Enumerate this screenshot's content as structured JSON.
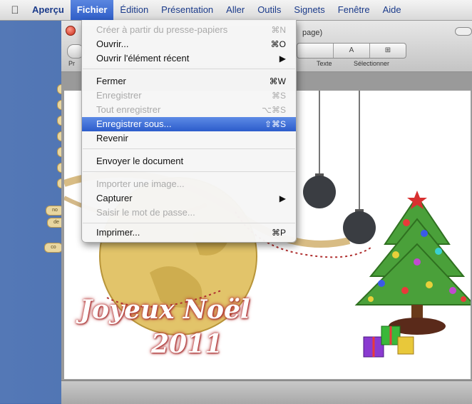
{
  "menubar": {
    "app_name": "Aperçu",
    "items": [
      "Fichier",
      "Édition",
      "Présentation",
      "Aller",
      "Outils",
      "Signets",
      "Fenêtre",
      "Aide"
    ],
    "active": "Fichier"
  },
  "window": {
    "title_fragment": "page)",
    "segmented": {
      "left": "A",
      "right": "⊞"
    },
    "tool_labels": {
      "left": "Pr",
      "text": "Texte",
      "select": "Sélectionner"
    }
  },
  "side_tags": [
    "no",
    "de",
    "co"
  ],
  "document": {
    "greeting_line1": "Joyeux Noël",
    "greeting_line2": "2011"
  },
  "file_menu": {
    "items": [
      {
        "label": "Créer à partir du presse-papiers",
        "shortcut": "⌘N",
        "disabled": true
      },
      {
        "label": "Ouvrir...",
        "shortcut": "⌘O",
        "disabled": false
      },
      {
        "label": "Ouvrir l'élément récent",
        "shortcut": "▶",
        "disabled": false
      },
      {
        "label": "Fermer",
        "shortcut": "⌘W",
        "disabled": false
      },
      {
        "label": "Enregistrer",
        "shortcut": "⌘S",
        "disabled": true
      },
      {
        "label": "Tout enregistrer",
        "shortcut": "⌥⌘S",
        "disabled": true
      },
      {
        "label": "Enregistrer sous...",
        "shortcut": "⇧⌘S",
        "disabled": false,
        "highlighted": true
      },
      {
        "label": "Revenir",
        "shortcut": "",
        "disabled": false
      },
      {
        "label": "Envoyer le document",
        "shortcut": "",
        "disabled": false
      },
      {
        "label": "Importer une image...",
        "shortcut": "",
        "disabled": true
      },
      {
        "label": "Capturer",
        "shortcut": "▶",
        "disabled": false
      },
      {
        "label": "Saisir le mot de passe...",
        "shortcut": "",
        "disabled": true
      },
      {
        "label": "Imprimer...",
        "shortcut": "⌘P",
        "disabled": false
      }
    ]
  },
  "colors": {
    "menu_highlight": "#3a6ad6",
    "desktop": "#4a6fb0",
    "ornament": "#3a3d42",
    "tree_green": "#4aa03a",
    "globe_gold": "#d9b85a"
  }
}
